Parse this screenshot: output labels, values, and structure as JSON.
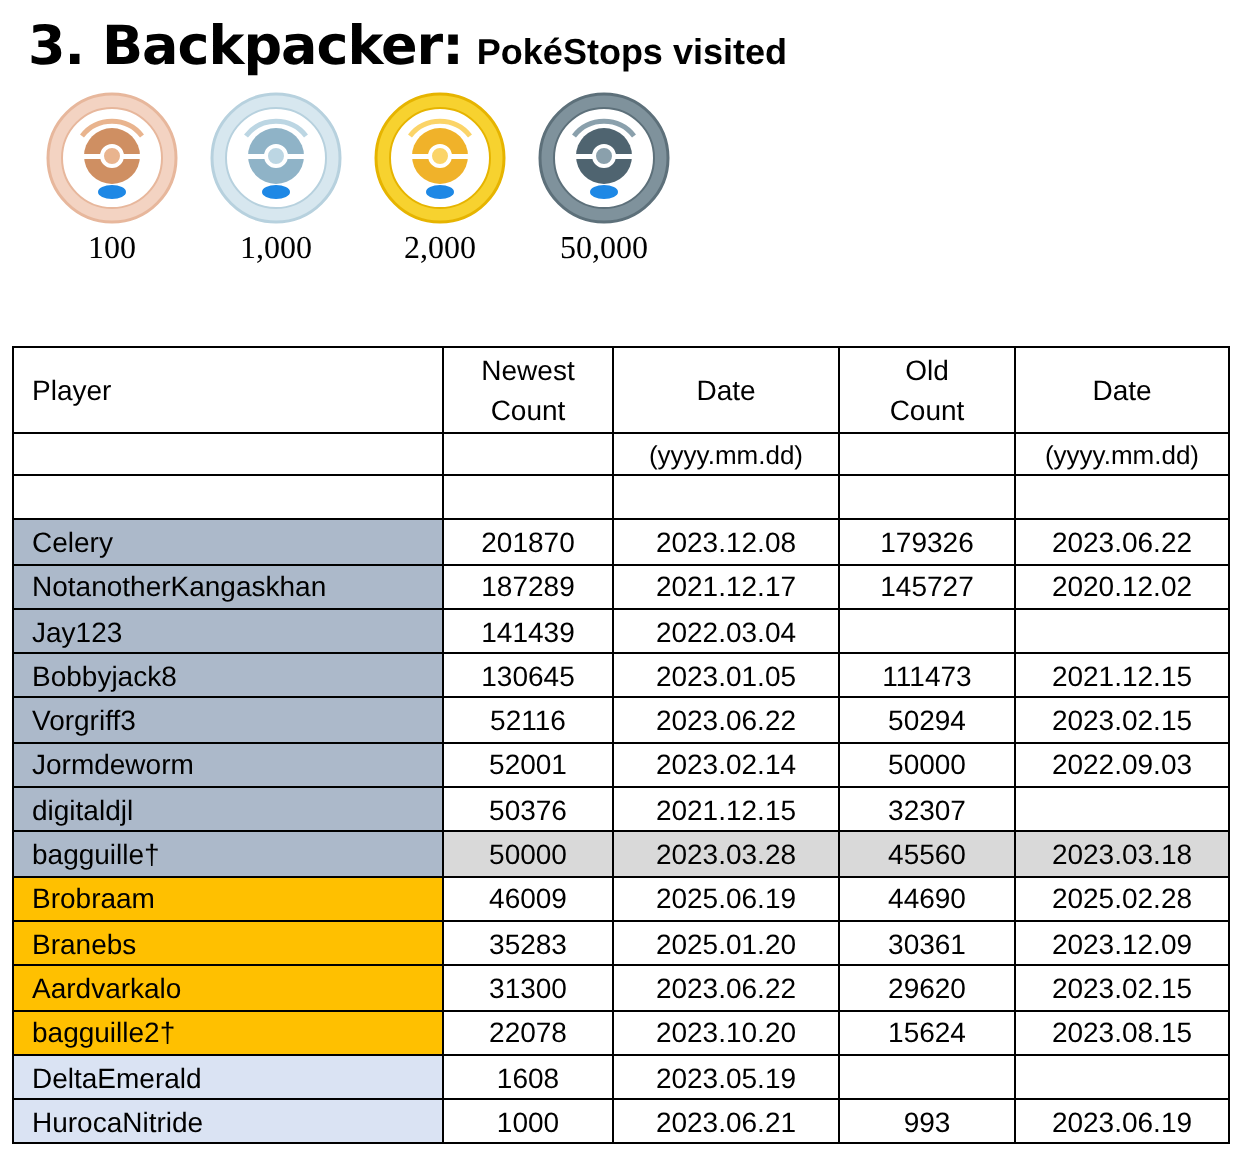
{
  "title": "3. Backpacker:",
  "subtitle": "PokéStops visited",
  "medals": [
    {
      "kind": "bronze",
      "label": "100"
    },
    {
      "kind": "silver",
      "label": "1,000"
    },
    {
      "kind": "gold",
      "label": "2,000"
    },
    {
      "kind": "platinum",
      "label": "50,000"
    }
  ],
  "table": {
    "columns": [
      {
        "label": "Player"
      },
      {
        "label": "Newest Count"
      },
      {
        "label": "Date",
        "unit": "(yyyy.mm.dd)"
      },
      {
        "label": "Old Count"
      },
      {
        "label": "Date",
        "unit": "(yyyy.mm.dd)"
      }
    ],
    "rows": [
      {
        "color": "#acb9ca",
        "shaded": false,
        "cells": [
          "Celery",
          "201870",
          "2023.12.08",
          "179326",
          "2023.06.22"
        ]
      },
      {
        "color": "#acb9ca",
        "shaded": false,
        "cells": [
          "NotanotherKangaskhan",
          "187289",
          "2021.12.17",
          "145727",
          "2020.12.02"
        ]
      },
      {
        "color": "#acb9ca",
        "shaded": false,
        "cells": [
          "Jay123",
          "141439",
          "2022.03.04",
          "",
          ""
        ]
      },
      {
        "color": "#acb9ca",
        "shaded": false,
        "cells": [
          "Bobbyjack8",
          "130645",
          "2023.01.05",
          "111473",
          "2021.12.15"
        ]
      },
      {
        "color": "#acb9ca",
        "shaded": false,
        "cells": [
          "Vorgriff3",
          "52116",
          "2023.06.22",
          "50294",
          "2023.02.15"
        ]
      },
      {
        "color": "#acb9ca",
        "shaded": false,
        "cells": [
          "Jormdeworm",
          "52001",
          "2023.02.14",
          "50000",
          "2022.09.03"
        ]
      },
      {
        "color": "#acb9ca",
        "shaded": false,
        "cells": [
          "digitaldjl",
          "50376",
          "2021.12.15",
          "32307",
          ""
        ]
      },
      {
        "color": "#acb9ca",
        "shaded": true,
        "cells": [
          "bagguille†",
          "50000",
          "2023.03.28",
          "45560",
          "2023.03.18"
        ]
      },
      {
        "color": "#ffc000",
        "shaded": false,
        "cells": [
          "Brobraam",
          "46009",
          "2025.06.19",
          "44690",
          "2025.02.28"
        ]
      },
      {
        "color": "#ffc000",
        "shaded": false,
        "cells": [
          "Branebs",
          "35283",
          "2025.01.20",
          "30361",
          "2023.12.09"
        ]
      },
      {
        "color": "#ffc000",
        "shaded": false,
        "cells": [
          "Aardvarkalo",
          "31300",
          "2023.06.22",
          "29620",
          "2023.02.15"
        ]
      },
      {
        "color": "#ffc000",
        "shaded": false,
        "cells": [
          "bagguille2†",
          "22078",
          "2023.10.20",
          "15624",
          "2023.08.15"
        ]
      },
      {
        "color": "#dae3f3",
        "shaded": false,
        "cells": [
          "DeltaEmerald",
          "1608",
          "2023.05.19",
          "",
          ""
        ]
      },
      {
        "color": "#dae3f3",
        "shaded": false,
        "cells": [
          "HurocaNitride",
          "1000",
          "2023.06.21",
          "993",
          "2023.06.19"
        ]
      }
    ]
  }
}
